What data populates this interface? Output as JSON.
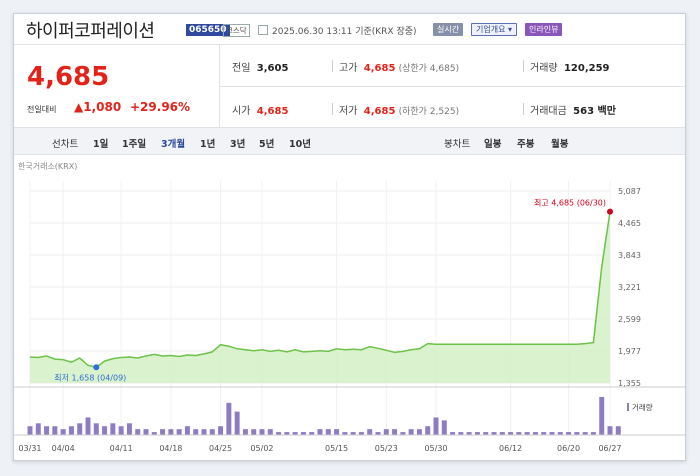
{
  "header": {
    "name": "하이퍼코퍼레이션",
    "code": "065650",
    "market": "코스닥",
    "datetime": "2025.06.30 13:11 기준(KRX 장중)",
    "tags": [
      "실시간",
      "기업개요 ▾",
      "인라인뷰"
    ]
  },
  "quote": {
    "price": "4,685",
    "change_label": "전일대비",
    "change": "▲1,080",
    "change_pct": "+29.96%",
    "prev_label": "전일",
    "prev": "3,605",
    "high_label": "고가",
    "high": "4,685",
    "high_note": "(상한가 4,685)",
    "volume_label": "거래량",
    "volume": "120,259",
    "open_label": "시가",
    "open": "4,685",
    "low_label": "저가",
    "low": "4,685",
    "low_note": "(하한가 2,525)",
    "amount_label": "거래대금",
    "amount": "563 백만"
  },
  "periods": {
    "label": "선차트",
    "items": [
      "1일",
      "1주일",
      "3개월",
      "1년",
      "3년",
      "5년",
      "10년"
    ],
    "selected": "3개월",
    "candle_label": "봉차트",
    "candle_items": [
      "일봉",
      "주봉",
      "월봉"
    ]
  },
  "colors": {
    "up": "#e2231a",
    "accent": "#2f4a9c",
    "line": "#6cc24a",
    "fill": "#d3f0c4",
    "volume": "#8e7cc3"
  },
  "chart_data": {
    "type": "area",
    "source_label": "한국거래소(KRX)",
    "x_ticks": [
      "03/31",
      "04/04",
      "04/11",
      "04/18",
      "04/25",
      "05/02",
      "05/15",
      "05/23",
      "05/30",
      "06/12",
      "06/20",
      "06/27"
    ],
    "y_ticks": [
      "5,087",
      "4,465",
      "3,843",
      "3,221",
      "2,599",
      "1,977",
      "1,355"
    ],
    "ylim": [
      1355,
      5087
    ],
    "series": [
      {
        "values": [
          1860,
          1850,
          1880,
          1820,
          1810,
          1760,
          1840,
          1700,
          1660,
          1780,
          1830,
          1850,
          1860,
          1840,
          1880,
          1910,
          1880,
          1890,
          1870,
          1900,
          1890,
          1920,
          1960,
          2100,
          2070,
          2020,
          2000,
          1980,
          2000,
          1970,
          1990,
          1960,
          2000,
          1960,
          1970,
          1980,
          1970,
          2020,
          2000,
          2010,
          2000,
          2060,
          2030,
          1990,
          1950,
          1970,
          2000,
          2020,
          2120,
          2110,
          2110,
          2110,
          2110,
          2110,
          2110,
          2110,
          2110,
          2110,
          2110,
          2110,
          2110,
          2110,
          2110,
          2110,
          2110,
          2110,
          2110,
          2120,
          2140,
          3605,
          4685
        ]
      }
    ],
    "annotations": {
      "max_label": "최고 4,685 (06/30)",
      "min_label": "최저 1,658 (04/09)"
    },
    "volume_legend": "거래량",
    "volume": [
      3,
      4,
      3,
      3,
      2,
      3,
      4,
      6,
      4,
      3,
      4,
      3,
      4,
      2,
      2,
      1,
      2,
      2,
      2,
      3,
      2,
      2,
      2,
      3,
      11,
      8,
      2,
      2,
      2,
      2,
      1,
      1,
      1,
      1,
      1,
      2,
      2,
      2,
      1,
      1,
      1,
      2,
      1,
      2,
      2,
      1,
      2,
      2,
      3,
      6,
      5,
      1,
      1,
      1,
      1,
      1,
      1,
      1,
      1,
      1,
      1,
      1,
      1,
      1,
      1,
      1,
      1,
      1,
      1,
      13,
      3,
      3
    ]
  }
}
